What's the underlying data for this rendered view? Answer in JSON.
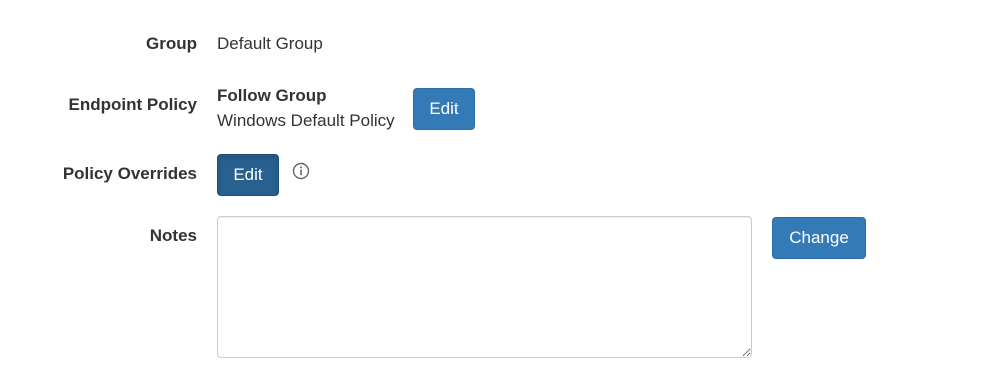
{
  "group": {
    "label": "Group",
    "value": "Default Group"
  },
  "endpoint_policy": {
    "label": "Endpoint Policy",
    "mode": "Follow Group",
    "policy_name": "Windows Default Policy",
    "edit_label": "Edit"
  },
  "policy_overrides": {
    "label": "Policy Overrides",
    "edit_label": "Edit",
    "info_icon": "info-circle-icon"
  },
  "notes": {
    "label": "Notes",
    "value": "",
    "change_label": "Change"
  },
  "colors": {
    "primary_button": "#337ab7",
    "primary_button_active": "#286090",
    "text": "#333333"
  }
}
